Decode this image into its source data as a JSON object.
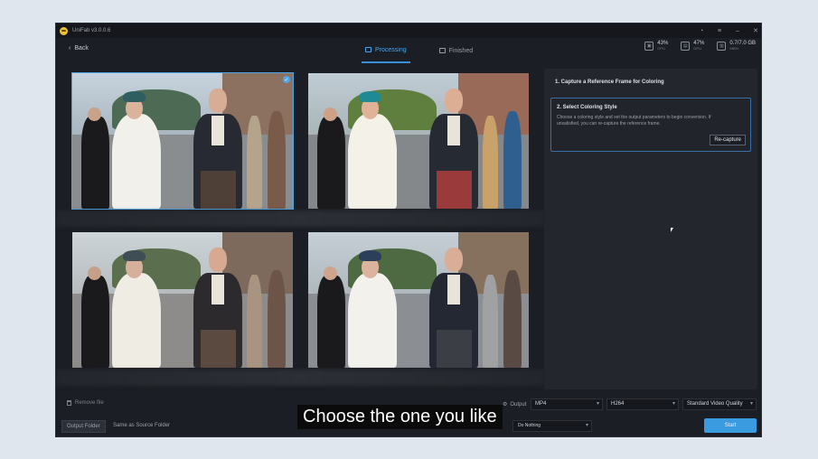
{
  "app": {
    "title": "UniFab v3.0.0.6"
  },
  "nav": {
    "back_label": "Back",
    "tabs": [
      {
        "label": "Processing",
        "active": true
      },
      {
        "label": "Finished",
        "active": false
      }
    ]
  },
  "stats": [
    {
      "icon": "cpu-icon",
      "value": "43%",
      "sub": "CPU"
    },
    {
      "icon": "gpu-icon",
      "value": "47%",
      "sub": "GPU"
    },
    {
      "icon": "memory-icon",
      "value": "0.7/7.0 GB",
      "sub": "MEM"
    }
  ],
  "panel": {
    "step1_title": "1. Capture a Reference Frame for Coloring",
    "step2_title": "2. Select Coloring Style",
    "step2_desc": "Choose a coloring style and set the output parameters to begin conversion. If unsatisfied, you can re-capture the reference frame.",
    "recapture_label": "Re-capture"
  },
  "bottom": {
    "remove_file_label": "Remove file",
    "output_label": "Output",
    "format_value": "MP4",
    "codec_value": "H264",
    "quality_value": "Standard Video Quality",
    "output_folder_label": "Output Folder",
    "output_folder_value": "Same as Source Folder",
    "after_done_value": "Do Nothing",
    "start_label": "Start"
  },
  "subtitle": "Choose the one you like",
  "colors": {
    "accent": "#3b9be0",
    "selected_border": "#4ea6e8",
    "window_bg": "#1b1e24"
  },
  "grid_options": [
    {
      "selected": true
    },
    {
      "selected": false
    },
    {
      "selected": false
    },
    {
      "selected": false
    }
  ]
}
